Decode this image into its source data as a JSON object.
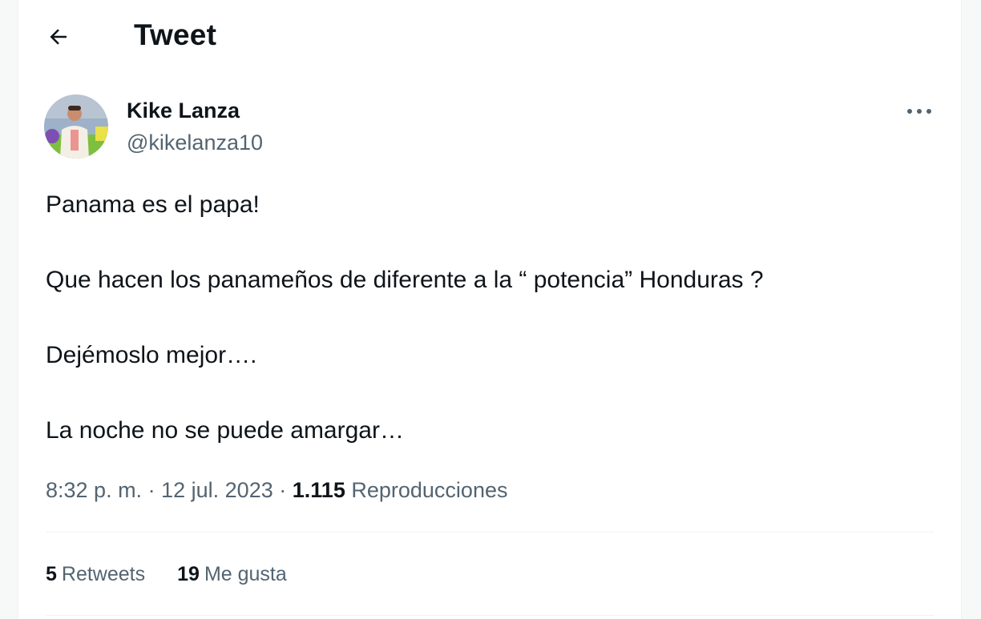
{
  "header": {
    "title": "Tweet",
    "back_icon": "arrow-left-icon"
  },
  "author": {
    "display_name": "Kike Lanza",
    "handle": "@kikelanza10",
    "avatar_icon": "avatar-photo",
    "more_icon": "more-horizontal-icon"
  },
  "tweet": {
    "lines": [
      "Panama es el papa!",
      "Que hacen los panameños de diferente a la “ potencia” Honduras ?",
      "Dejémoslo mejor….",
      "La noche no se puede amargar…"
    ]
  },
  "meta": {
    "time": "8:32 p. m.",
    "separator": "·",
    "date": "12 jul. 2023",
    "views_count": "1.115",
    "views_label": "Reproducciones"
  },
  "stats": {
    "retweets_count": "5",
    "retweets_label": "Retweets",
    "likes_count": "19",
    "likes_label": "Me gusta"
  },
  "colors": {
    "text_primary": "#0f1419",
    "text_secondary": "#536471",
    "divider": "#eff3f4"
  }
}
